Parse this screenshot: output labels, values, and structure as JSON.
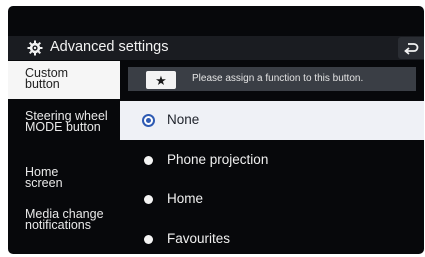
{
  "header": {
    "title": "Advanced settings",
    "gear_icon": "gear-icon",
    "back_icon": "back-arrow-icon"
  },
  "sidebar": {
    "items": [
      {
        "label": "Custom button",
        "active": true
      },
      {
        "label": "Steering wheel MODE button",
        "active": false
      },
      {
        "label": "Home screen",
        "active": false
      },
      {
        "label": "Media change notifications",
        "active": false
      }
    ]
  },
  "content": {
    "info": {
      "star_icon": "star-icon",
      "text": "Please assign a function to this button."
    },
    "options": [
      {
        "label": "None",
        "selected": true
      },
      {
        "label": "Phone projection",
        "selected": false
      },
      {
        "label": "Home",
        "selected": false
      },
      {
        "label": "Favourites",
        "selected": false
      }
    ]
  },
  "colors": {
    "background": "#07080b",
    "header": "#1a1c21",
    "accent": "#2f5bb3",
    "selected_row": "#eff1f6",
    "info_bar": "#3a3e45"
  }
}
